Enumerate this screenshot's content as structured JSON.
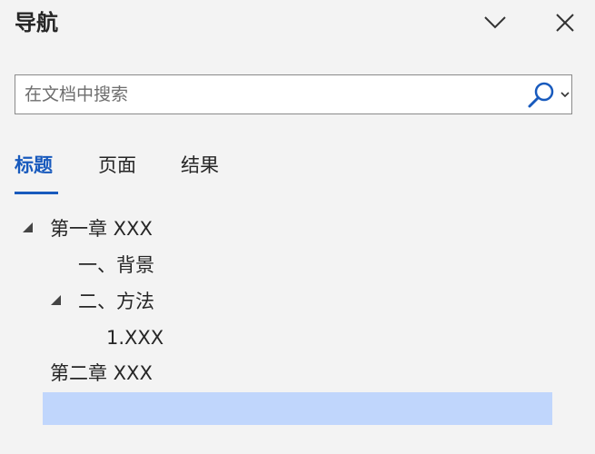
{
  "pane": {
    "title": "导航"
  },
  "search": {
    "placeholder": "在文档中搜索",
    "value": ""
  },
  "tabs": [
    {
      "label": "标题",
      "active": true
    },
    {
      "label": "页面",
      "active": false
    },
    {
      "label": "结果",
      "active": false
    }
  ],
  "tree": [
    {
      "label": "第一章 XXX",
      "expanded": true
    },
    {
      "label": "一、背景"
    },
    {
      "label": "二、方法",
      "expanded": true
    },
    {
      "label": "1.XXX"
    },
    {
      "label": "第二章 XXX"
    }
  ],
  "icons": {
    "options": "chevron-down-icon",
    "close": "close-icon",
    "search": "search-icon",
    "search_dropdown": "chevron-down-icon"
  },
  "colors": {
    "accent": "#185abd",
    "selection": "#c0d6fc",
    "background": "#f3f3f3"
  }
}
